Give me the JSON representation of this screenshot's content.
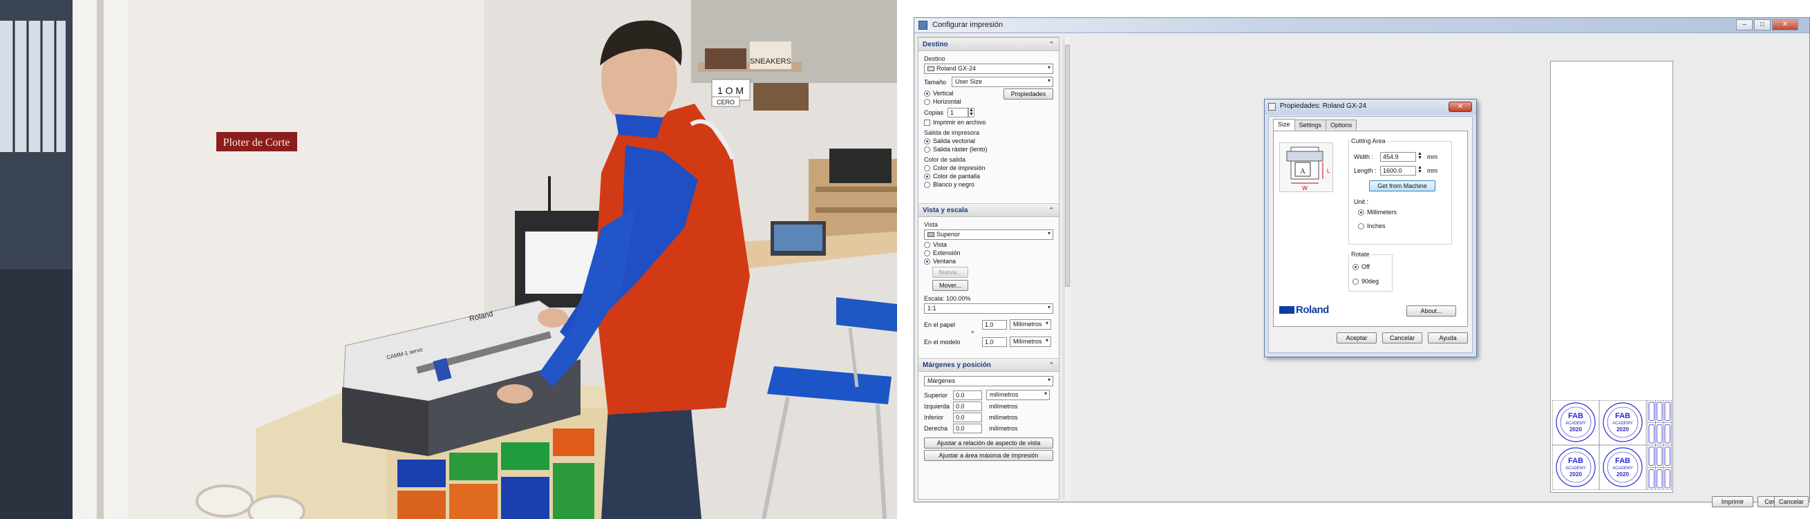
{
  "photo": {
    "wall_sign": "Ploter de Corte",
    "plotter_brand": "Roland",
    "plotter_model": "CAMM-1 servo",
    "box_labels": [
      "1 O M",
      "CERO",
      "SNEAKERS"
    ]
  },
  "window": {
    "title": "Configurar impresión",
    "controls": {
      "minimize": "–",
      "maximize": "□",
      "close": "✕"
    }
  },
  "destino": {
    "header": "Destino",
    "label": "Destino",
    "printer": "Roland GX-24",
    "size_label": "Tamaño",
    "size_value": "User Size",
    "orientation": [
      "Vertical",
      "Horizontal"
    ],
    "orientation_selected": 0,
    "properties_button": "Propiedades",
    "copies_label": "Copias",
    "copies_value": "1",
    "print_to_file": "Imprimir en archivo",
    "output_label": "Salida de impresora",
    "output_options": [
      "Salida vectorial",
      "Salida ráster (lento)"
    ],
    "output_selected": 0,
    "color_label": "Color de salida",
    "color_options": [
      "Color de impresión",
      "Color de pantalla",
      "Blanco y negro"
    ],
    "color_selected": 1
  },
  "vista": {
    "header": "Vista y escala",
    "label": "Vista",
    "view_value": "Superior",
    "view_options": [
      "Vista",
      "Extensión",
      "Ventana"
    ],
    "view_selected": 2,
    "new_button": "Nueva...",
    "move_button": "Mover...",
    "scale_label": "Escala: 100.00%",
    "scale_value": "1:1",
    "paper_label": "En el papel",
    "paper_value": "1.0",
    "paper_unit": "Milímetros",
    "equals": "=",
    "model_label": "En el modelo",
    "model_value": "1.0",
    "model_unit": "Milímetros"
  },
  "margenes": {
    "header": "Márgenes y posición",
    "margins_value": "Márgenes",
    "fields": [
      {
        "label": "Superior",
        "value": "0.0",
        "unit": "milímetros"
      },
      {
        "label": "Izquierda",
        "value": "0.0",
        "unit": "milímetros"
      },
      {
        "label": "Inferior",
        "value": "0.0",
        "unit": "milímetros"
      },
      {
        "label": "Derecha",
        "value": "0.0",
        "unit": "milímetros"
      }
    ],
    "aspect_button": "Ajustar a relación de aspecto de vista",
    "maxarea_button": "Ajustar a área máxima de impresión"
  },
  "dialog": {
    "title": "Propiedades: Roland GX-24",
    "tabs": [
      "Size",
      "Settings",
      "Options"
    ],
    "active_tab": 0,
    "cutting_area": "Cutting Area",
    "width_label": "Width :",
    "width_value": "454.9",
    "length_label": "Length :",
    "length_value": "1600.0",
    "mm": "mm",
    "get_from_machine": "Get from Machine",
    "unit_label": "Unit :",
    "unit_options": [
      "Millimeters",
      "Inches"
    ],
    "unit_selected": 0,
    "rotate_label": "Rotate",
    "rotate_options": [
      "Off",
      "90deg"
    ],
    "rotate_selected": 0,
    "diagram_w": "W",
    "diagram_l": "L",
    "diagram_a": "A",
    "logo": "Roland",
    "about_button": "About...",
    "ok_button": "Aceptar",
    "cancel_button": "Cancelar",
    "help_button": "Ayuda"
  },
  "sticker": {
    "top": "FAB",
    "mid": "ACADEMY",
    "year": "2020"
  },
  "footer": {
    "print_button": "Imprimir",
    "close_button": "Cerrar",
    "cancel_button": "Cancelar"
  },
  "colors": {
    "accent": "#1c4f9c",
    "sticker_ink": "#2b2bd0",
    "vest": "#d23a16",
    "logo_blue": "#0d3ea0"
  }
}
